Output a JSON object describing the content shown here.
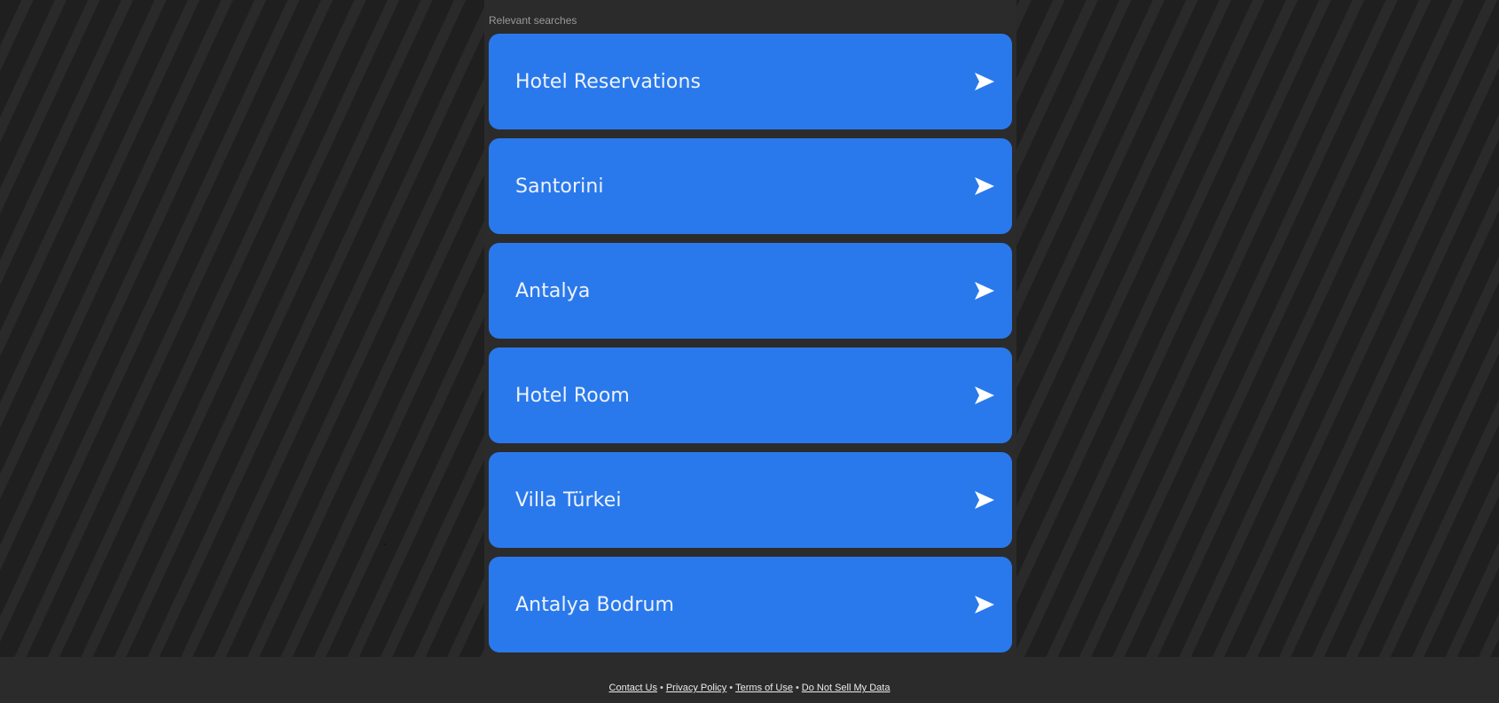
{
  "relevant_searches": {
    "heading": "Relevant searches",
    "items": [
      {
        "label": "Hotel Reservations",
        "icon": "arrow-right-icon"
      },
      {
        "label": "Santorini",
        "icon": "arrow-right-icon"
      },
      {
        "label": "Antalya",
        "icon": "arrow-right-icon"
      },
      {
        "label": "Hotel Room",
        "icon": "arrow-right-icon"
      },
      {
        "label": "Villa Türkei",
        "icon": "arrow-right-icon"
      },
      {
        "label": "Antalya Bodrum",
        "icon": "arrow-right-icon"
      }
    ]
  },
  "footer": {
    "links": [
      {
        "label": "Contact Us"
      },
      {
        "label": "Privacy Policy"
      },
      {
        "label": "Terms of Use"
      },
      {
        "label": "Do Not Sell My Data"
      }
    ],
    "separator": "•"
  },
  "colors": {
    "accent": "#2a79ec",
    "page_background": "#212121",
    "panel_background": "#2b2b2b"
  }
}
